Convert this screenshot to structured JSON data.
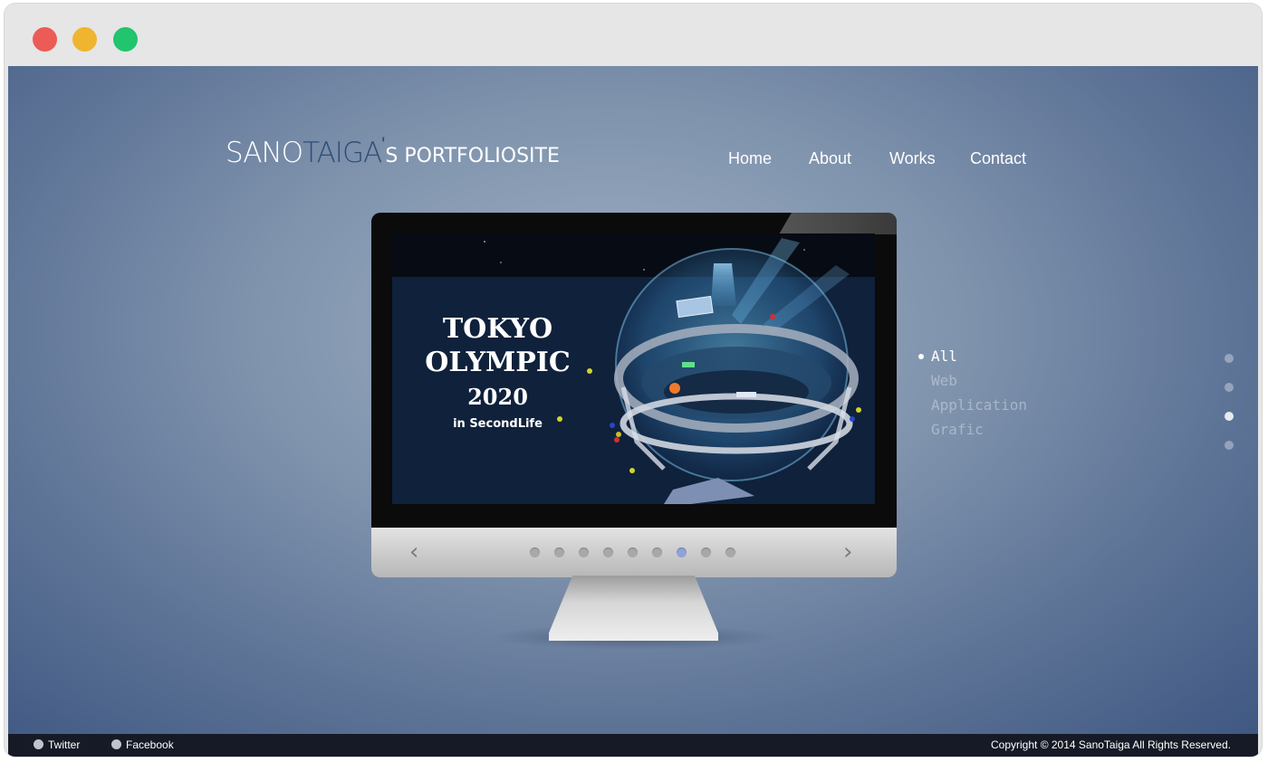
{
  "window": {
    "controls": [
      "close",
      "minimize",
      "zoom"
    ]
  },
  "header": {
    "logo": {
      "part1": "SANO",
      "part2": "TAIGA",
      "apostrophe": "'",
      "part3": "S PORTFOLIOSITE"
    },
    "nav": [
      "Home",
      "About",
      "Works",
      "Contact"
    ]
  },
  "slide": {
    "title_line1": "TOKYO",
    "title_line2": "OLYMPIC",
    "title_line3": "2020",
    "subtitle": "in SecondLife"
  },
  "slider": {
    "prev_icon": "chevron-left-icon",
    "next_icon": "chevron-right-icon",
    "dot_count": 9,
    "active_index": 6
  },
  "filter": {
    "items": [
      "All",
      "Web",
      "Application",
      "Grafic"
    ],
    "selected": "All"
  },
  "side_nav": {
    "dot_count": 4,
    "active_index": 2
  },
  "footer": {
    "links": [
      "Twitter",
      "Facebook"
    ],
    "copyright": "Copyright © 2014 SanoTaiga All Rights Reserved."
  },
  "colors": {
    "accent": "#2e4e78",
    "background": "#7f93ad",
    "footer": "#151a26"
  }
}
